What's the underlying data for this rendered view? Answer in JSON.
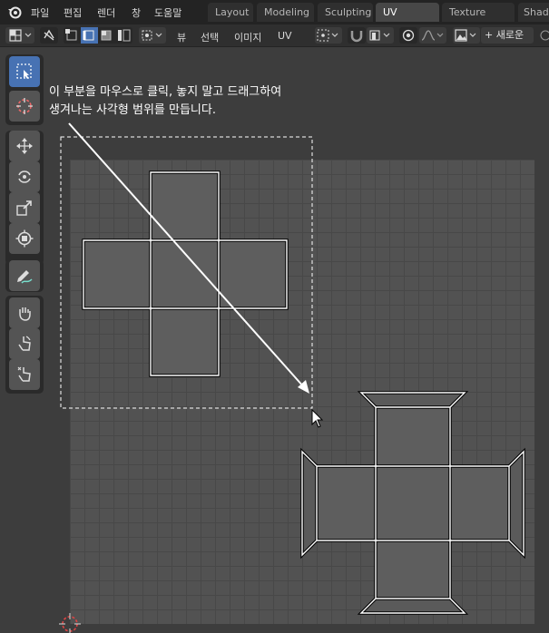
{
  "menubar": {
    "menus": [
      "파일",
      "편집",
      "렌더",
      "창",
      "도움말"
    ],
    "workspaces": [
      "Layout",
      "Modeling",
      "Sculpting",
      "UV Editing",
      "Texture Paint",
      "Shad"
    ],
    "active_workspace": "UV Editing"
  },
  "header": {
    "menus": [
      "뷰",
      "선택",
      "이미지",
      "UV"
    ],
    "new_button": "+ 새로운"
  },
  "toolbar": {
    "tools": [
      "select-box",
      "cursor",
      "move",
      "rotate",
      "scale",
      "transform",
      "annotate",
      "grab",
      "relax",
      "pinch"
    ],
    "active_tool": "select-box"
  },
  "instruction": {
    "line1": "이 부분을 마우스로 클릭, 놓지 말고 드래그하여",
    "line2": "생겨나는 사각형 범위를 만듭니다."
  },
  "colors": {
    "active_blue": "#4772b3",
    "grid_background": "#525252",
    "uv_edge": "#ffffff"
  }
}
